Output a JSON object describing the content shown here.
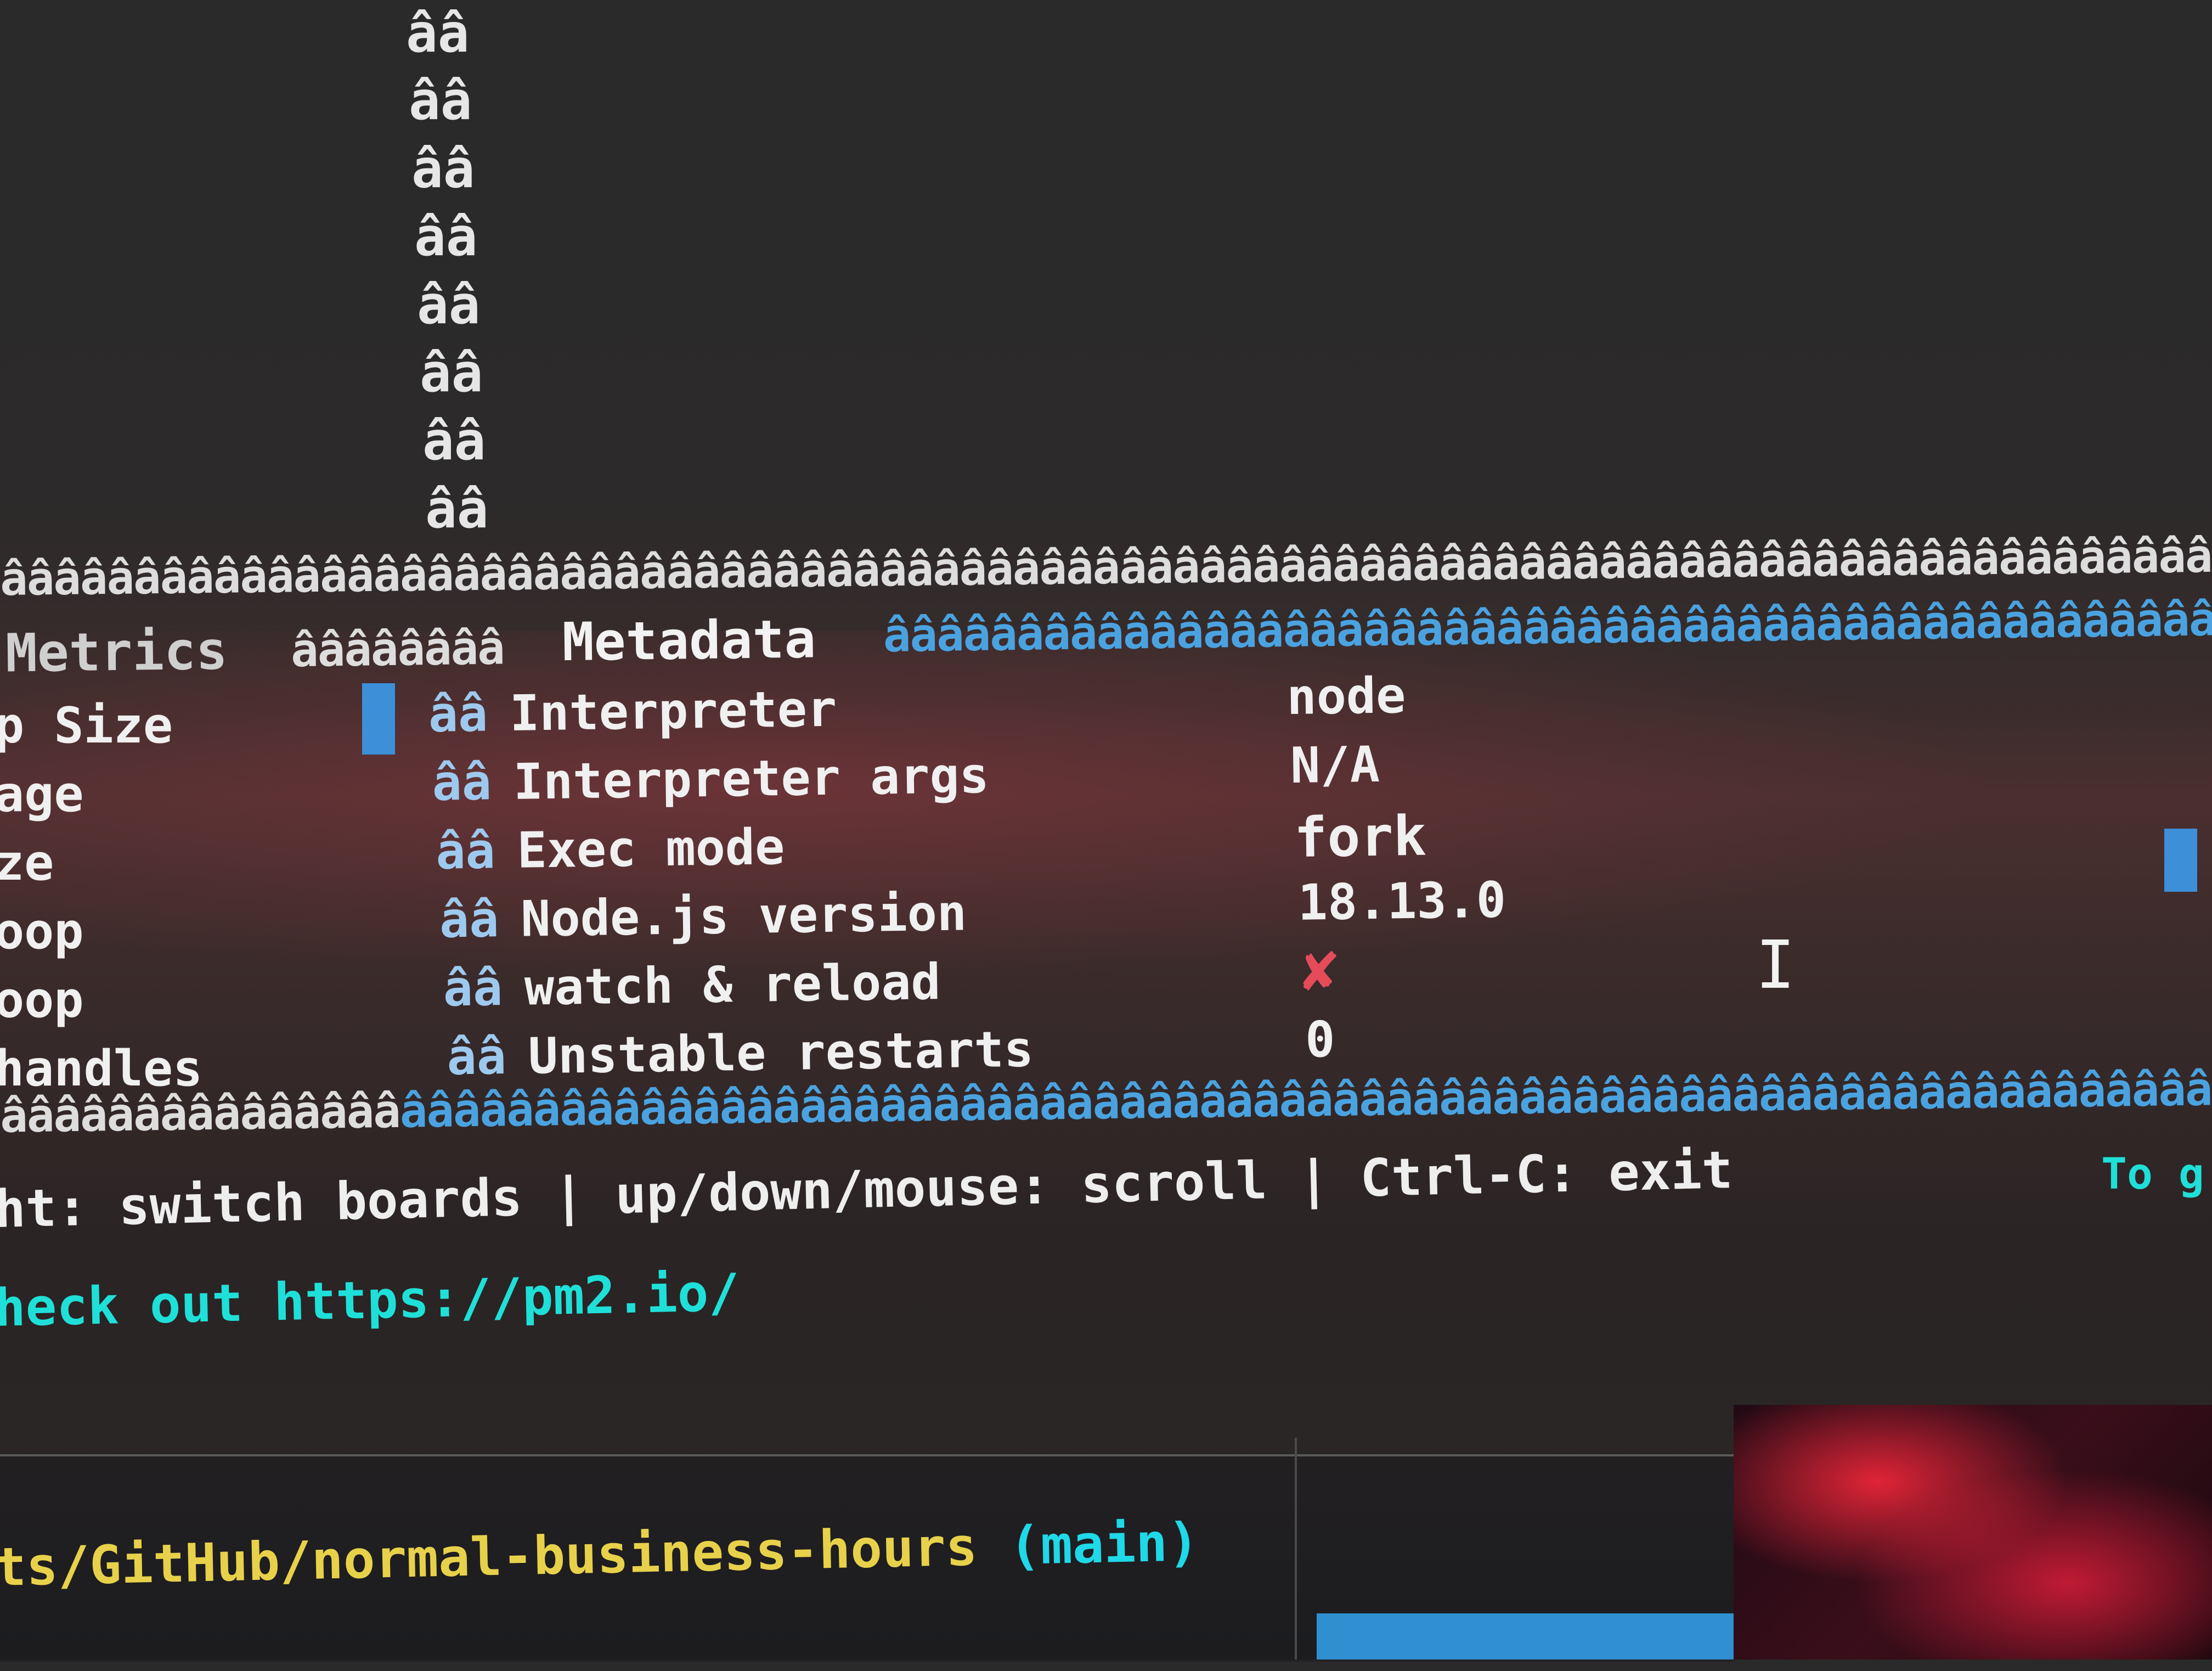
{
  "border": {
    "glyphs": [
      "ââ",
      "ââ",
      "ââ",
      "ââ",
      "ââ",
      "ââ",
      "ââ",
      "ââ"
    ],
    "rule_top": "âââââââââââââââââââââââââââââââââââââââââââââââââââââââââââââââââââââââââââââââââââââââââââââââââââ",
    "rule_bottom_left": "âââââââââââââââ",
    "rule_bottom_right": "âââââââââââââââââââââââââââââââââââââââââââââââââââââââââââââââââââââââââââââââââââââââ"
  },
  "panels": {
    "metrics_title": "Metrics",
    "metrics_rule": "ââââââââ",
    "metadata_title": "Metadata",
    "metadata_rule": "ââââââââââââââââââââââââââââââââââââââââââââââââââââââââââ"
  },
  "metrics_labels": [
    "p Size",
    "age",
    "ze",
    "oop",
    "oop",
    "handles"
  ],
  "row_prefix": "ââ",
  "metadata_rows": [
    {
      "label": "Interpreter",
      "value": "node"
    },
    {
      "label": "Interpreter args",
      "value": "N/A"
    },
    {
      "label": "Exec mode",
      "value": "fork"
    },
    {
      "label": "Node.js version",
      "value": "18.13.0"
    },
    {
      "label": "watch & reload",
      "value": "✘"
    },
    {
      "label": "Unstable restarts",
      "value": "0"
    }
  ],
  "help_line": "ht: switch boards | up/down/mouse: scroll | Ctrl-C: exit",
  "check_line": "heck out https://pm2.io/",
  "to_fragment": "To g",
  "text_cursor": "I",
  "prompt": {
    "path": "ts/GitHub/normal-business-hours",
    "branch": "(main)"
  },
  "colors": {
    "accent_blue": "#4aa3e0",
    "cyan": "#1fe0d8",
    "error_red": "#e64b5a",
    "path_yellow": "#e8d14a"
  }
}
